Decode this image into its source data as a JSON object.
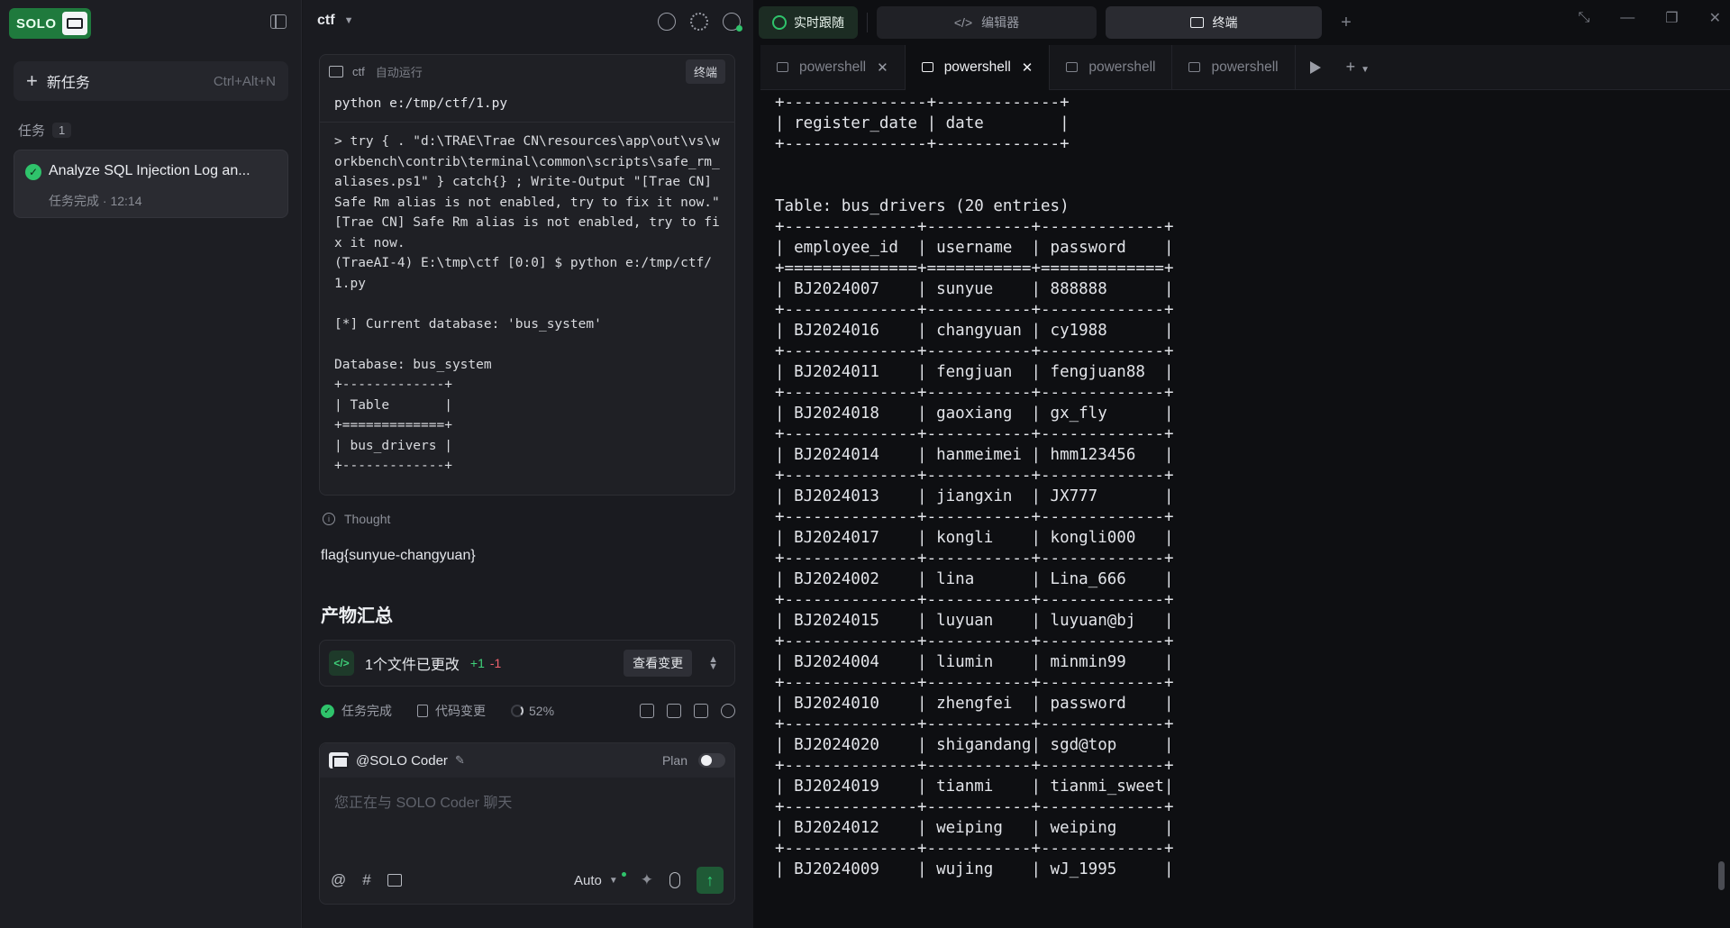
{
  "sidebar": {
    "logo_text": "SOLO",
    "new_task_label": "新任务",
    "new_task_shortcut": "Ctrl+Alt+N",
    "tasks_label": "任务",
    "tasks_count": "1",
    "task": {
      "title": "Analyze SQL Injection Log an...",
      "meta": "任务完成 · 12:14"
    }
  },
  "chat": {
    "project": "ctf",
    "term_card": {
      "title": "ctf",
      "auto_label": "自动运行",
      "terminal_button": "终端",
      "command": "python e:/tmp/ctf/1.py",
      "output": "> try { . \"d:\\TRAE\\Trae CN\\resources\\app\\out\\vs\\workbench\\contrib\\terminal\\common\\scripts\\safe_rm_aliases.ps1\" } catch{} ; Write-Output \"[Trae CN] Safe Rm alias is not enabled, try to fix it now.\"\n[Trae CN] Safe Rm alias is not enabled, try to fix it now.\n(TraeAI-4) E:\\tmp\\ctf [0:0] $ python e:/tmp/ctf/1.py\n\n[*] Current database: 'bus_system'\n\nDatabase: bus_system\n+-------------+\n| Table       |\n+=============+\n| bus_drivers |\n+-------------+"
    },
    "thought_label": "Thought",
    "flag_text": "flag{sunyue-changyuan}",
    "artifacts_title": "产物汇总",
    "change": {
      "text": "1个文件已更改",
      "added": "+1",
      "removed": "-1",
      "view_button": "查看变更"
    },
    "status": {
      "done": "任务完成",
      "code_changes": "代码变更",
      "progress": "52%"
    },
    "input": {
      "agent": "@SOLO Coder",
      "plan_label": "Plan",
      "placeholder": "您正在与 SOLO Coder 聊天",
      "mode": "Auto"
    }
  },
  "right": {
    "top_tabs": {
      "live": "实时跟随",
      "editor": "编辑器",
      "terminal": "终端"
    },
    "terminal_tabs": [
      "powershell",
      "powershell",
      "powershell",
      "powershell"
    ],
    "terminal_output": "+---------------+-------------+\n| register_date | date        |\n+---------------+-------------+\n\n\nTable: bus_drivers (20 entries)\n+--------------+-----------+-------------+\n| employee_id  | username  | password    |\n+==============+===========+=============+\n| BJ2024007    | sunyue    | 888888      |\n+--------------+-----------+-------------+\n| BJ2024016    | changyuan | cy1988      |\n+--------------+-----------+-------------+\n| BJ2024011    | fengjuan  | fengjuan88  |\n+--------------+-----------+-------------+\n| BJ2024018    | gaoxiang  | gx_fly      |\n+--------------+-----------+-------------+\n| BJ2024014    | hanmeimei | hmm123456   |\n+--------------+-----------+-------------+\n| BJ2024013    | jiangxin  | JX777       |\n+--------------+-----------+-------------+\n| BJ2024017    | kongli    | kongli000   |\n+--------------+-----------+-------------+\n| BJ2024002    | lina      | Lina_666    |\n+--------------+-----------+-------------+\n| BJ2024015    | luyuan    | luyuan@bj   |\n+--------------+-----------+-------------+\n| BJ2024004    | liumin    | minmin99    |\n+--------------+-----------+-------------+\n| BJ2024010    | zhengfei  | password    |\n+--------------+-----------+-------------+\n| BJ2024020    | shigandang| sgd@top     |\n+--------------+-----------+-------------+\n| BJ2024019    | tianmi    | tianmi_sweet|\n+--------------+-----------+-------------+\n| BJ2024012    | weiping   | weiping     |\n+--------------+-----------+-------------+\n| BJ2024009    | wujing    | wJ_1995     |"
  }
}
